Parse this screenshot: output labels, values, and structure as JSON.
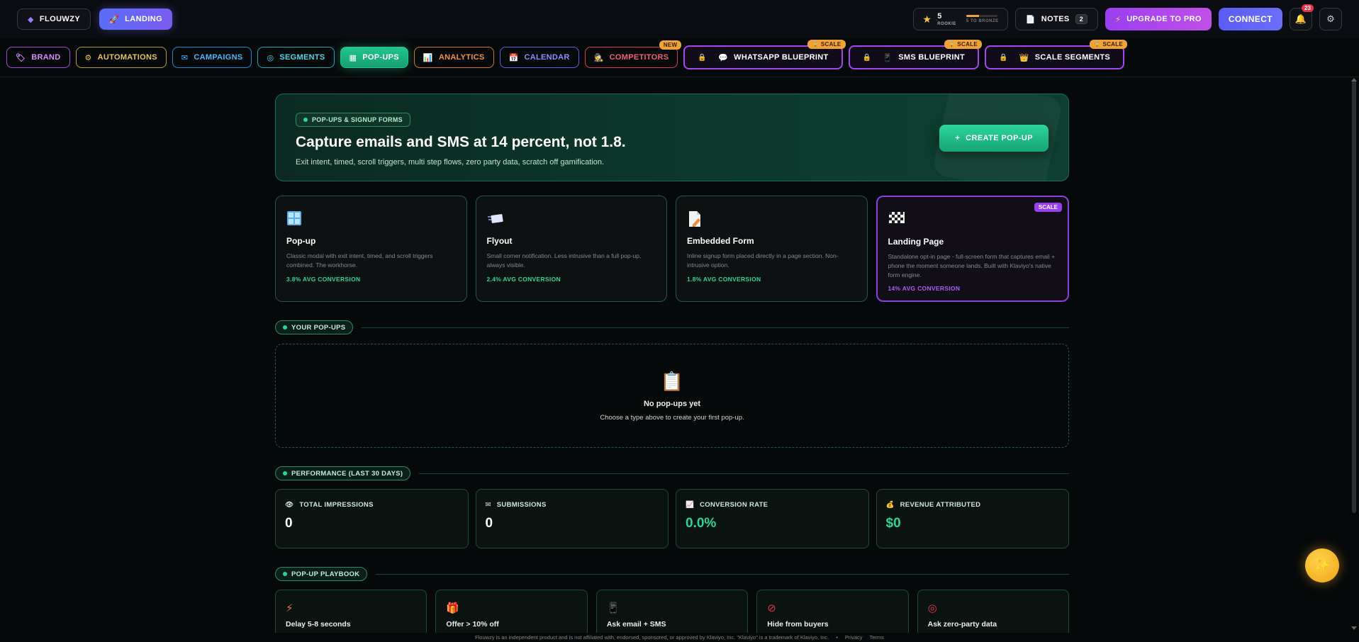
{
  "topbar": {
    "brand": "FLOUWZY",
    "landing": "LANDING",
    "xp_level": "5",
    "xp_rank": "ROOKIE",
    "xp_progress": 0.4,
    "xp_next": "5 TO BRONZE",
    "notes_label": "NOTES",
    "notes_count": "2",
    "upgrade_label": "UPGRADE TO PRO",
    "connect_label": "CONNECT",
    "notif_count": "23"
  },
  "nav": {
    "brand": "BRAND",
    "automations": "AUTOMATIONS",
    "campaigns": "CAMPAIGNS",
    "segments": "SEGMENTS",
    "popups": "POP-UPS",
    "analytics": "ANALYTICS",
    "calendar": "CALENDAR",
    "competitors": "COMPETITORS",
    "competitors_badge": "NEW",
    "whatsapp": "WHATSAPP BLUEPRINT",
    "sms": "SMS BLUEPRINT",
    "scale_segments": "SCALE SEGMENTS",
    "scale_badge": "SCALE"
  },
  "hero": {
    "chip": "POP-UPS & SIGNUP FORMS",
    "title": "Capture emails and SMS at 14 percent, not 1.8.",
    "subtitle": "Exit intent, timed, scroll triggers, multi step flows, zero party data, scratch off gamification.",
    "button": "CREATE POP-UP"
  },
  "types": [
    {
      "title": "Pop-up",
      "desc": "Classic modal with exit intent, timed, and scroll triggers combined. The workhorse.",
      "conv": "3.8% AVG CONVERSION",
      "icon": "window-icon"
    },
    {
      "title": "Flyout",
      "desc": "Small corner notification. Less intrusive than a full pop-up, always visible.",
      "conv": "2.4% AVG CONVERSION",
      "icon": "flyout-icon"
    },
    {
      "title": "Embedded Form",
      "desc": "Inline signup form placed directly in a page section. Non-intrusive option.",
      "conv": "1.8% AVG CONVERSION",
      "icon": "form-icon"
    },
    {
      "title": "Landing Page",
      "desc": "Standalone opt-in page - full-screen form that captures email + phone the moment someone lands. Built with Klaviyo's native form engine.",
      "conv": "14% AVG CONVERSION",
      "icon": "checkered-flag-icon",
      "badge": "SCALE"
    }
  ],
  "your_popups": {
    "heading": "YOUR POP-UPS",
    "empty_title": "No pop-ups yet",
    "empty_sub": "Choose a type above to create your first pop-up."
  },
  "performance": {
    "heading": "PERFORMANCE (LAST 30 DAYS)",
    "stats": [
      {
        "label": "TOTAL IMPRESSIONS",
        "value": "0"
      },
      {
        "label": "SUBMISSIONS",
        "value": "0"
      },
      {
        "label": "CONVERSION RATE",
        "value": "0.0%"
      },
      {
        "label": "REVENUE ATTRIBUTED",
        "value": "$0"
      }
    ]
  },
  "playbook": {
    "heading": "POP-UP PLAYBOOK",
    "items": [
      {
        "title": "Delay 5-8 seconds"
      },
      {
        "title": "Offer > 10% off"
      },
      {
        "title": "Ask email + SMS"
      },
      {
        "title": "Hide from buyers"
      },
      {
        "title": "Ask zero-party data"
      }
    ]
  },
  "footer": {
    "disclaimer": "Flouwzy is an independent product and is not affiliated with, endorsed, sponsored, or approved by Klaviyo, Inc. \"Klaviyo\" is a trademark of Klaviyo, Inc.",
    "sep": "•",
    "privacy": "Privacy",
    "terms": "Terms"
  },
  "colors": {
    "accent": "#2bd59a",
    "scale": "#9a3ff0",
    "background": "#06090a"
  }
}
